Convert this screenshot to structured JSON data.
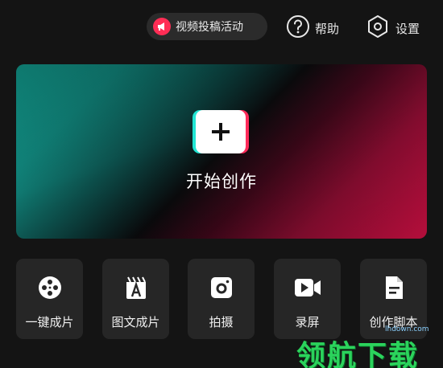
{
  "topbar": {
    "campaign_label": "视频投稿活动",
    "help_label": "帮助",
    "settings_label": "设置"
  },
  "hero": {
    "label": "开始创作"
  },
  "tools": [
    {
      "label": "一键成片",
      "icon": "film-reel-icon"
    },
    {
      "label": "图文成片",
      "icon": "image-text-icon"
    },
    {
      "label": "拍摄",
      "icon": "camera-icon"
    },
    {
      "label": "录屏",
      "icon": "screen-record-icon"
    },
    {
      "label": "创作脚本",
      "icon": "script-document-icon"
    }
  ],
  "watermark": {
    "url": "lhdown.com",
    "logo": "领航下载"
  },
  "colors": {
    "background": "#141414",
    "accent_red": "#ff2d55",
    "teal": "#15b9a9",
    "crimson": "#d31045"
  }
}
